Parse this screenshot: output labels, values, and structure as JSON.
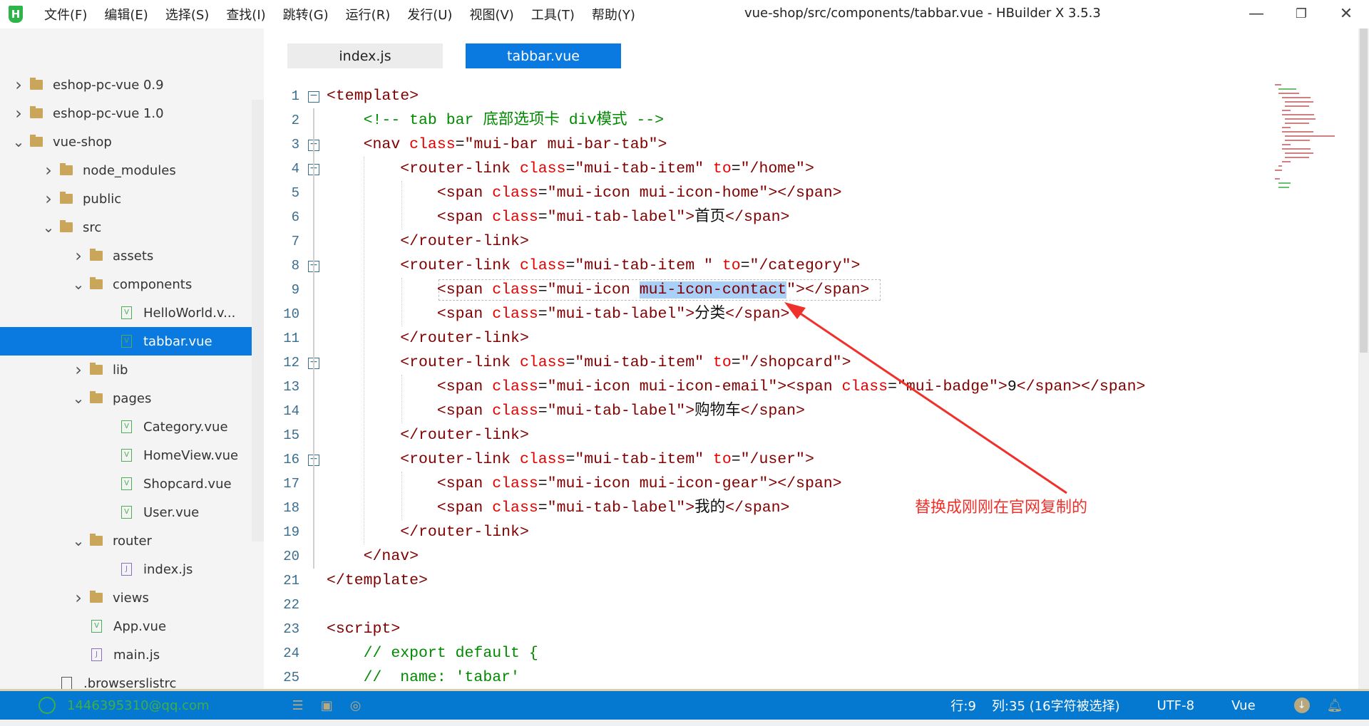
{
  "menu": [
    "文件(F)",
    "编辑(E)",
    "选择(S)",
    "查找(I)",
    "跳转(G)",
    "运行(R)",
    "发行(U)",
    "视图(V)",
    "工具(T)",
    "帮助(Y)"
  ],
  "window_title": "vue-shop/src/components/tabbar.vue - HBuilder X 3.5.3",
  "tabs": [
    {
      "label": "index.js",
      "active": false
    },
    {
      "label": "tabbar.vue",
      "active": true
    }
  ],
  "tree": [
    {
      "label": "eshop-pc-vue 0.9",
      "depth": 0,
      "type": "project",
      "state": "collapsed"
    },
    {
      "label": "eshop-pc-vue 1.0",
      "depth": 0,
      "type": "project",
      "state": "collapsed"
    },
    {
      "label": "vue-shop",
      "depth": 0,
      "type": "project",
      "state": "expanded"
    },
    {
      "label": "node_modules",
      "depth": 1,
      "type": "folder",
      "state": "collapsed"
    },
    {
      "label": "public",
      "depth": 1,
      "type": "folder",
      "state": "collapsed"
    },
    {
      "label": "src",
      "depth": 1,
      "type": "folder",
      "state": "expanded"
    },
    {
      "label": "assets",
      "depth": 2,
      "type": "folder",
      "state": "collapsed"
    },
    {
      "label": "components",
      "depth": 2,
      "type": "folder",
      "state": "expanded"
    },
    {
      "label": "HelloWorld.v...",
      "depth": 3,
      "type": "vue"
    },
    {
      "label": "tabbar.vue",
      "depth": 3,
      "type": "vue",
      "selected": true
    },
    {
      "label": "lib",
      "depth": 2,
      "type": "folder",
      "state": "collapsed"
    },
    {
      "label": "pages",
      "depth": 2,
      "type": "folder",
      "state": "expanded"
    },
    {
      "label": "Category.vue",
      "depth": 3,
      "type": "vue"
    },
    {
      "label": "HomeView.vue",
      "depth": 3,
      "type": "vue"
    },
    {
      "label": "Shopcard.vue",
      "depth": 3,
      "type": "vue"
    },
    {
      "label": "User.vue",
      "depth": 3,
      "type": "vue"
    },
    {
      "label": "router",
      "depth": 2,
      "type": "folder",
      "state": "expanded"
    },
    {
      "label": "index.js",
      "depth": 3,
      "type": "js"
    },
    {
      "label": "views",
      "depth": 2,
      "type": "folder",
      "state": "collapsed"
    },
    {
      "label": "App.vue",
      "depth": 2,
      "type": "vue"
    },
    {
      "label": "main.js",
      "depth": 2,
      "type": "js"
    },
    {
      "label": ".browserslistrc",
      "depth": 1,
      "type": "file"
    }
  ],
  "code": [
    "<template>",
    "    <!-- tab bar 底部选项卡 div模式 -->",
    "    <nav class=\"mui-bar mui-bar-tab\">",
    "        <router-link class=\"mui-tab-item\" to=\"/home\">",
    "            <span class=\"mui-icon mui-icon-home\"></span>",
    "            <span class=\"mui-tab-label\">首页</span>",
    "        </router-link>",
    "        <router-link class=\"mui-tab-item \" to=\"/category\">",
    "            <span class=\"mui-icon mui-icon-contact\"></span>",
    "            <span class=\"mui-tab-label\">分类</span>",
    "        </router-link>",
    "        <router-link class=\"mui-tab-item\" to=\"/shopcard\">",
    "            <span class=\"mui-icon mui-icon-email\"><span class=\"mui-badge\">9</span></span>",
    "            <span class=\"mui-tab-label\">购物车</span>",
    "        </router-link>",
    "        <router-link class=\"mui-tab-item\" to=\"/user\">",
    "            <span class=\"mui-icon mui-icon-gear\"></span>",
    "            <span class=\"mui-tab-label\">我的</span>",
    "        </router-link>",
    "    </nav>",
    "</template>",
    "",
    "<script>",
    "    // export default {",
    "    //  name: 'tabar'"
  ],
  "fold_lines": [
    1,
    3,
    4,
    8,
    12,
    16
  ],
  "selection": {
    "line": 9,
    "text": "mui-icon-contact"
  },
  "annotation": "替换成刚刚在官网复制的",
  "status": {
    "user": "1446395310@qq.com",
    "position": "行:9",
    "column": "列:35 (16字符被选择)",
    "encoding": "UTF-8",
    "language": "Vue"
  },
  "colors": {
    "accent": "#0a7ae0",
    "status_bar": "#0479cf",
    "annotation": "#f0302a"
  }
}
